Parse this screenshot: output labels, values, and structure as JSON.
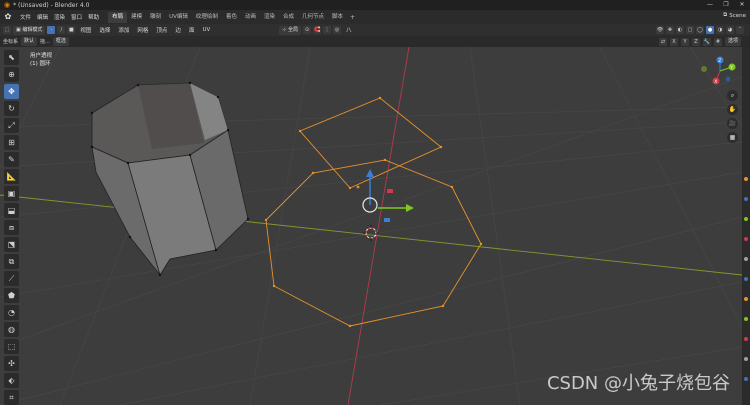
{
  "window": {
    "title": "* (Unsaved) - Blender 4.0",
    "controls": [
      "—",
      "❐",
      "✕"
    ]
  },
  "menu": [
    "文件",
    "编辑",
    "渲染",
    "窗口",
    "帮助"
  ],
  "workspaces": [
    "布局",
    "建模",
    "雕刻",
    "UV编辑",
    "纹理绘制",
    "着色",
    "动画",
    "渲染",
    "合成",
    "几何节点",
    "脚本"
  ],
  "active_workspace": "布局",
  "scene_name": "Scene",
  "header": {
    "mode": "编辑模式",
    "view_menu": [
      "视图",
      "选择",
      "添加",
      "网格",
      "顶点",
      "边",
      "面",
      "UV"
    ],
    "transform_orientation": "全局",
    "overlay_options": "选项",
    "proportional_label": "八"
  },
  "tool_header": {
    "orientation_label": "坐标系",
    "orientation_value": "默认",
    "drag_label": "拖...",
    "drag_value": "框选",
    "axis_x": "X",
    "axis_y": "Y",
    "axis_z": "Z"
  },
  "viewport": {
    "view_name": "用户透视",
    "object_name": "(1) 圆环"
  },
  "watermark": "CSDN @小兔子烧包谷",
  "colors": {
    "viewport_bg": "#3d3d3d",
    "selection_orange": "#e8922a",
    "x_axis": "#c0394b",
    "y_axis": "#8aac2e",
    "z_axis": "#3a7fd4"
  }
}
